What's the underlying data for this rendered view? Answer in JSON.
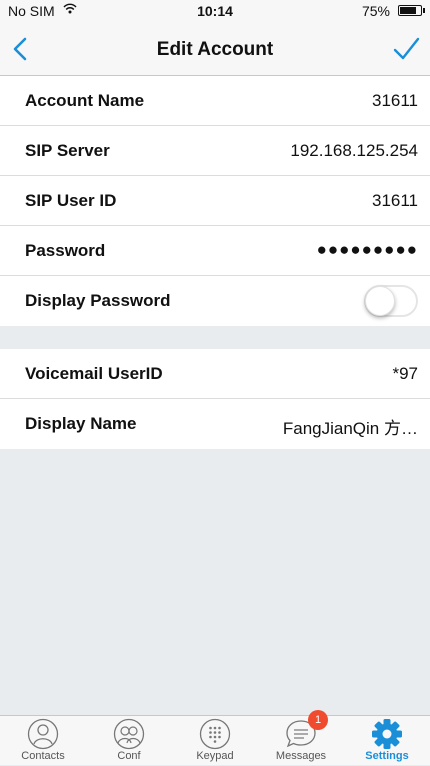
{
  "status_bar": {
    "carrier": "No SIM",
    "time": "10:14",
    "battery": "75%"
  },
  "nav": {
    "title": "Edit Account"
  },
  "account_fields": [
    {
      "label": "Account Name",
      "value": "31611"
    },
    {
      "label": "SIP Server",
      "value": "192.168.125.254"
    },
    {
      "label": "SIP User ID",
      "value": "31611"
    },
    {
      "label": "Password",
      "value": "●●●●●●●●●"
    },
    {
      "label": "Display Password",
      "toggle": false
    }
  ],
  "extra_fields": [
    {
      "label": "Voicemail UserID",
      "value": "*97"
    },
    {
      "label": "Display Name",
      "value": "FangJianQin 方…"
    }
  ],
  "tab_bar": {
    "tabs": [
      {
        "label": "Contacts",
        "icon": "person-icon"
      },
      {
        "label": "Conf",
        "icon": "group-icon"
      },
      {
        "label": "Keypad",
        "icon": "keypad-icon"
      },
      {
        "label": "Messages",
        "icon": "chat-bubble-icon",
        "badge": "1"
      },
      {
        "label": "Settings",
        "icon": "gear-icon",
        "active": true
      }
    ]
  },
  "colors": {
    "accent": "#1a8fd8",
    "badge": "#f04b2f",
    "background": "#e9ecee"
  }
}
